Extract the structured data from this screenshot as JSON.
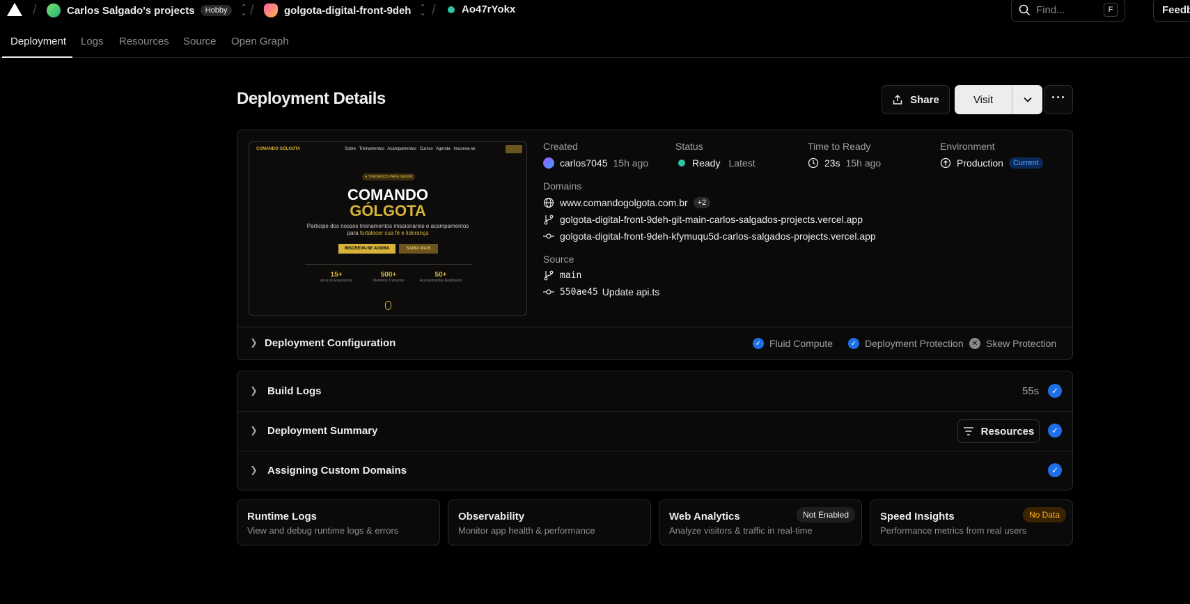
{
  "topbar": {
    "team": "Carlos Salgado's projects",
    "plan": "Hobby",
    "project": "golgota-digital-front-9deh",
    "deployment_id": "Ao47rYokx",
    "find_placeholder": "Find...",
    "find_shortcut": "F",
    "feedback": "Feedb"
  },
  "tabs": [
    "Deployment",
    "Logs",
    "Resources",
    "Source",
    "Open Graph"
  ],
  "page_title": "Deployment Details",
  "actions": {
    "share": "Share",
    "visit": "Visit"
  },
  "preview": {
    "brand": "COMANDO GÓLGOTA",
    "nav_links": "Sobre Treinamentos Acampamentos Cursos Agenda Inscreva-se",
    "pill": "★ TREINADOS PARA SERVIR",
    "title_1": "COMANDO",
    "title_2": "GÓLGOTA",
    "subtitle_1": "Participe dos nossos treinamentos missionários e acampamentos",
    "subtitle_2a": "para ",
    "subtitle_2b": "fortalecer sua fé e liderança",
    "btn_primary": "INSCREVA-SE AGORA",
    "btn_secondary": "SAIBA MAIS",
    "stats": [
      {
        "n": "15+",
        "l": "Anos de Experiência"
      },
      {
        "n": "500+",
        "l": "Membros Treinados"
      },
      {
        "n": "50+",
        "l": "Acampamentos Realizados"
      }
    ]
  },
  "details": {
    "created_label": "Created",
    "created_user": "carlos7045",
    "created_time": "15h ago",
    "status_label": "Status",
    "status_value": "Ready",
    "status_extra": "Latest",
    "ttr_label": "Time to Ready",
    "ttr_value": "23s",
    "ttr_time": "15h ago",
    "env_label": "Environment",
    "env_value": "Production",
    "env_badge": "Current",
    "domains_label": "Domains",
    "domains": [
      "www.comandogolgota.com.br",
      "golgota-digital-front-9deh-git-main-carlos-salgados-projects.vercel.app",
      "golgota-digital-front-9deh-kfymuqu5d-carlos-salgados-projects.vercel.app"
    ],
    "domains_more": "+2",
    "source_label": "Source",
    "branch": "main",
    "commit_hash": "550ae45",
    "commit_msg": "Update api.ts"
  },
  "config": {
    "title": "Deployment Configuration",
    "features": [
      {
        "label": "Fluid Compute",
        "enabled": true
      },
      {
        "label": "Deployment Protection",
        "enabled": true
      },
      {
        "label": "Skew Protection",
        "enabled": false
      }
    ]
  },
  "steps": [
    {
      "title": "Build Logs",
      "meta": "55s"
    },
    {
      "title": "Deployment Summary",
      "meta": "Resources"
    },
    {
      "title": "Assigning Custom Domains",
      "meta": ""
    }
  ],
  "cards": [
    {
      "title": "Runtime Logs",
      "desc": "View and debug runtime logs & errors",
      "badge": ""
    },
    {
      "title": "Observability",
      "desc": "Monitor app health & performance",
      "badge": ""
    },
    {
      "title": "Web Analytics",
      "desc": "Analyze visitors & traffic in real-time",
      "badge": "Not Enabled"
    },
    {
      "title": "Speed Insights",
      "desc": "Performance metrics from real users",
      "badge": "No Data"
    }
  ],
  "colors": {
    "accent_blue": "#1f6fe6",
    "status_green": "#2fc7a5",
    "gold": "#d8b33a"
  }
}
